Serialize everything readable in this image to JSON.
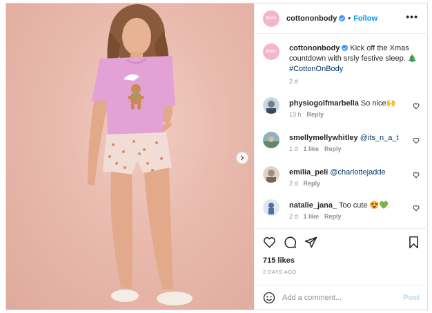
{
  "header": {
    "username": "cottononbody",
    "follow_label": "Follow",
    "separator": "•",
    "avatar_text": "BODY",
    "more_label": "•••"
  },
  "caption": {
    "username": "cottononbody",
    "text": "Kick off the Xmas countdown with srsly festive sleep.",
    "emoji": "🎄",
    "hashtag": "#CottonOnBody",
    "age": "2 d"
  },
  "comments": [
    {
      "username": "physiogolfmarbella",
      "text": "So nice🙌",
      "mention": "",
      "age": "13 h",
      "likes": "",
      "reply_label": "Reply"
    },
    {
      "username": "smellymellywhitley",
      "text": "",
      "mention": "@its_n_a_t",
      "age": "1 d",
      "likes": "1 like",
      "reply_label": "Reply"
    },
    {
      "username": "emilia_peli",
      "text": "",
      "mention": "@charlottejadde",
      "age": "2 d",
      "likes": "",
      "reply_label": "Reply"
    },
    {
      "username": "natalie_jana_",
      "text": "Too cute 😍💚",
      "mention": "",
      "age": "2 d",
      "likes": "1 like",
      "reply_label": "Reply"
    }
  ],
  "actions": {
    "likes": "715 likes",
    "date": "2 DAYS AGO"
  },
  "add_comment": {
    "placeholder": "Add a comment...",
    "post_label": "Post"
  },
  "icons": {
    "verified": "verified-badge-icon",
    "like": "heart-icon",
    "comment": "comment-icon",
    "share": "paper-plane-icon",
    "save": "bookmark-icon",
    "emoji": "smiley-icon",
    "next": "chevron-right-icon"
  },
  "colors": {
    "accent": "#0095f6",
    "mention": "#00376b",
    "muted": "#8e8e8e",
    "post_disabled": "#b2dffc",
    "backdrop": "#e9b9ad"
  }
}
